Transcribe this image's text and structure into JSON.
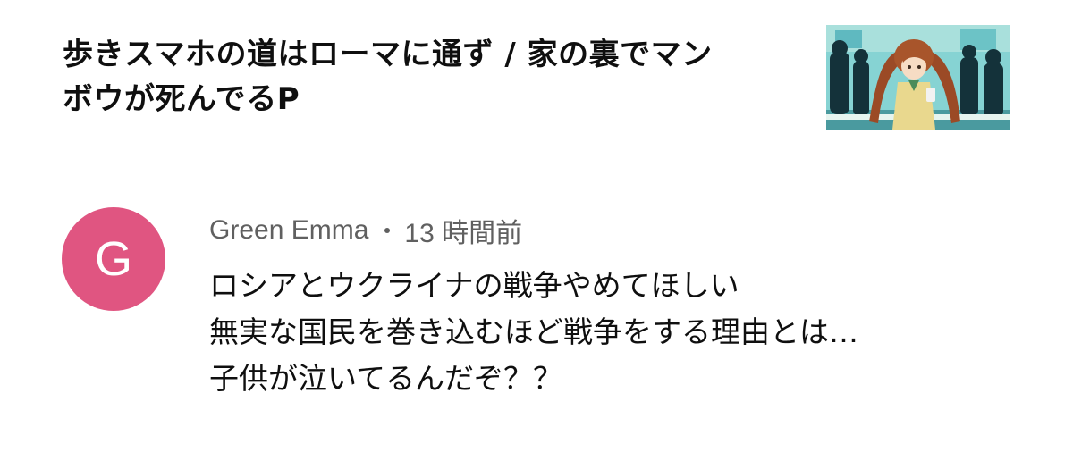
{
  "video": {
    "title_line1": "歩きスマホの道はローマに通ず / 家の裏でマン",
    "title_line2": "ボウが死んでるP",
    "thumbnail": "anime-girl-thumbnail"
  },
  "comment": {
    "avatar_letter": "G",
    "avatar_color": "#e05581",
    "author": "Green Emma",
    "separator": "•",
    "time": "13 時間前",
    "lines": [
      "ロシアとウクライナの戦争やめてほしい",
      "無実な国民を巻き込むほど戦争をする理由とは…",
      "子供が泣いてるんだぞ？？"
    ]
  }
}
